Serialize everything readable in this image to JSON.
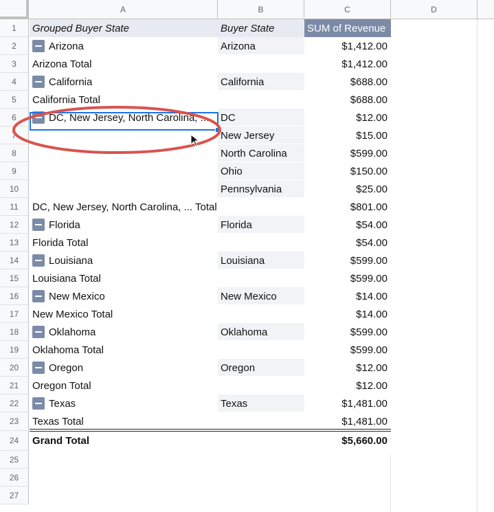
{
  "columns": [
    "A",
    "B",
    "C",
    "D"
  ],
  "rows": [
    "1",
    "2",
    "3",
    "4",
    "5",
    "6",
    "7",
    "8",
    "9",
    "10",
    "11",
    "12",
    "13",
    "14",
    "15",
    "16",
    "17",
    "18",
    "19",
    "20",
    "21",
    "22",
    "23",
    "24",
    "25",
    "26",
    "27"
  ],
  "header": {
    "grouped": "Grouped Buyer State",
    "buyer": "Buyer State",
    "metric": "SUM of Revenue"
  },
  "data": [
    {
      "a": "Arizona",
      "b": "Arizona",
      "c": "$1,412.00"
    },
    {
      "a": "Arizona Total",
      "b": "",
      "c": "$1,412.00"
    },
    {
      "a": "California",
      "b": "California",
      "c": "$688.00"
    },
    {
      "a": "California Total",
      "b": "",
      "c": "$688.00"
    },
    {
      "a": "DC, New Jersey, North Carolina, ...",
      "b": "DC",
      "c": "$12.00"
    },
    {
      "a": "",
      "b": "New Jersey",
      "c": "$15.00"
    },
    {
      "a": "",
      "b": "North Carolina",
      "c": "$599.00"
    },
    {
      "a": "",
      "b": "Ohio",
      "c": "$150.00"
    },
    {
      "a": "",
      "b": "Pennsylvania",
      "c": "$25.00"
    },
    {
      "a": "DC, New Jersey, North Carolina, ... Total",
      "b": "",
      "c": "$801.00"
    },
    {
      "a": "Florida",
      "b": "Florida",
      "c": "$54.00"
    },
    {
      "a": "Florida Total",
      "b": "",
      "c": "$54.00"
    },
    {
      "a": "Louisiana",
      "b": "Louisiana",
      "c": "$599.00"
    },
    {
      "a": "Louisiana Total",
      "b": "",
      "c": "$599.00"
    },
    {
      "a": "New Mexico",
      "b": "New Mexico",
      "c": "$14.00"
    },
    {
      "a": "New Mexico Total",
      "b": "",
      "c": "$14.00"
    },
    {
      "a": "Oklahoma",
      "b": "Oklahoma",
      "c": "$599.00"
    },
    {
      "a": "Oklahoma Total",
      "b": "",
      "c": "$599.00"
    },
    {
      "a": "Oregon",
      "b": "Oregon",
      "c": "$12.00"
    },
    {
      "a": "Oregon Total",
      "b": "",
      "c": "$12.00"
    },
    {
      "a": "Texas",
      "b": "Texas",
      "c": "$1,481.00"
    },
    {
      "a": "Texas Total",
      "b": "",
      "c": "$1,481.00"
    },
    {
      "a": "Grand Total",
      "b": "",
      "c": "$5,660.00"
    }
  ],
  "colors": {
    "header_band": "#e7ebf1",
    "metric_header": "#7b8ba7",
    "selection": "#1a73e8",
    "annotation": "#d9534f"
  }
}
